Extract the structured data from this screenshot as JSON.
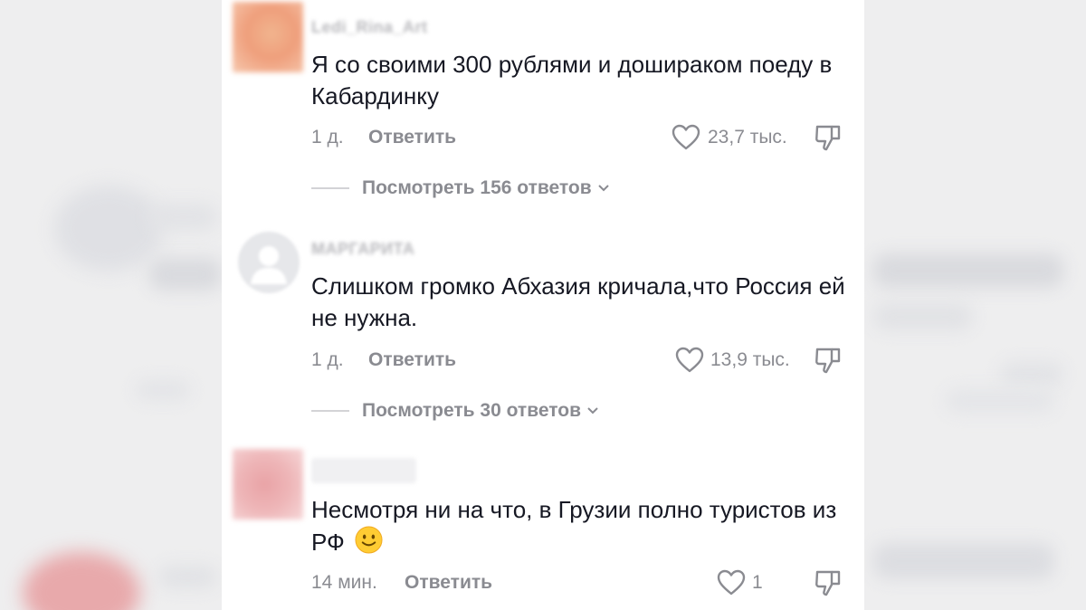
{
  "comments": [
    {
      "username": "Ledi_Rina_Art",
      "text": "Я со своими 300 рублями и дошираком поеду в Кабардинку",
      "time": "1 д.",
      "reply_label": "Ответить",
      "likes": "23,7 тыс.",
      "replies_label": "Посмотреть 156 ответов"
    },
    {
      "username": "МАРГАРИТА",
      "text": "Слишком громко Абхазия кричала,что Россия ей не нужна.",
      "time": "1 д.",
      "reply_label": "Ответить",
      "likes": "13,9 тыс.",
      "replies_label": "Посмотреть 30 ответов"
    },
    {
      "username": "",
      "text": "Несмотря ни на что, в Грузии полно туристов из РФ",
      "time": "14 мин.",
      "reply_label": "Ответить",
      "likes": "1"
    }
  ],
  "icons": {
    "like": "heart-outline-icon",
    "dislike": "thumbs-down-icon",
    "chevron": "chevron-down-icon",
    "emoji": "slightly-smiling-face-emoji"
  },
  "colors": {
    "text": "#161823",
    "muted": "#8a8b91",
    "background": "#ffffff"
  }
}
